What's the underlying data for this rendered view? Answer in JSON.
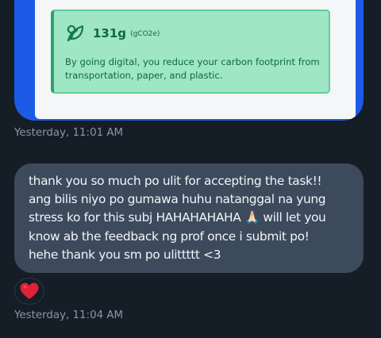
{
  "carbon_card": {
    "value": "131g",
    "unit": "(gCO2e)",
    "description": "By going digital, you reduce your carbon footprint from transportation, paper, and plastic.",
    "icon": "leaf-icon"
  },
  "messages": [
    {
      "timestamp": "Yesterday, 11:01 AM"
    },
    {
      "text": "thank you so much po ulit for accepting the task!!\nang bilis niyo po gumawa huhu natanggal na yung\nstress ko for this subj HAHAHAHAHA 🙏🏻 will let you\nknow ab the feedback ng prof once i submit po!\nhehe thank you sm po ulittttt <3",
      "reaction": "heart-icon",
      "timestamp": "Yesterday, 11:04 AM"
    }
  ],
  "colors": {
    "background": "#151d27",
    "card_frame": "#1d5be6",
    "carbon_box_bg": "#9ee6c4",
    "carbon_text": "#0e6a3f",
    "bubble_bg": "#3c4a5c",
    "timestamp": "#8a96a6",
    "reaction_heart": "#e0213a"
  }
}
